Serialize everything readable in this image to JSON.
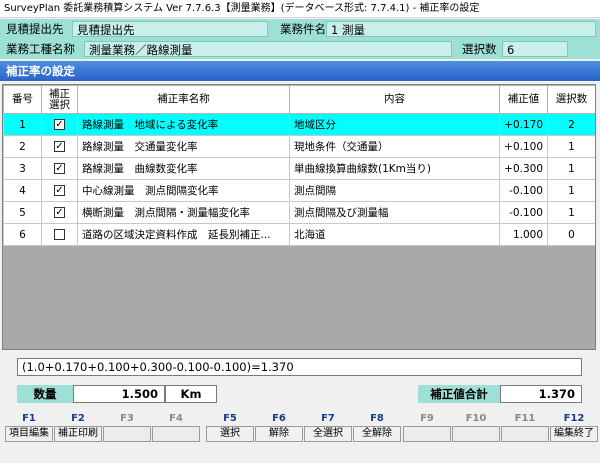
{
  "window": {
    "title": "SurveyPlan 委託業務積算システム Ver 7.7.6.3【測量業務】(データベース形式: 7.7.4.1) - 補正率の設定"
  },
  "info": {
    "submit_label": "見積提出先",
    "submit_value": "見積提出先",
    "project_label": "業務件名",
    "project_value": "1 測量",
    "category_label": "業務工種名称",
    "category_value": "測量業務／路線測量",
    "selected_label": "選択数",
    "selected_value": "6"
  },
  "section": {
    "title": "補正率の設定"
  },
  "table": {
    "headers": {
      "num": "番号",
      "select": "補正\n選択",
      "name": "補正率名称",
      "content": "内容",
      "value": "補正値",
      "count": "選択数"
    },
    "rows": [
      {
        "num": "1",
        "checked": true,
        "name": "路線測量　地域による変化率",
        "content": "地域区分",
        "value": "+0.170",
        "count": "2",
        "selected": true
      },
      {
        "num": "2",
        "checked": true,
        "name": "路線測量　交通量変化率",
        "content": "現地条件（交通量）",
        "value": "+0.100",
        "count": "1",
        "selected": false
      },
      {
        "num": "3",
        "checked": true,
        "name": "路線測量　曲線数変化率",
        "content": "単曲線換算曲線数(1Km当り)",
        "value": "+0.300",
        "count": "1",
        "selected": false
      },
      {
        "num": "4",
        "checked": true,
        "name": "中心線測量　測点間隔変化率",
        "content": "測点間隔",
        "value": "-0.100",
        "count": "1",
        "selected": false
      },
      {
        "num": "5",
        "checked": true,
        "name": "横断測量　測点間隔・測量幅変化率",
        "content": "測点間隔及び測量幅",
        "value": "-0.100",
        "count": "1",
        "selected": false
      },
      {
        "num": "6",
        "checked": false,
        "name": "道路の区域決定資料作成　延長別補正...",
        "content": "北海道",
        "value": "1.000",
        "count": "0",
        "selected": false
      }
    ]
  },
  "formula": "(1.0+0.170+0.100+0.300-0.100-0.100)=1.370",
  "summary": {
    "qty_label": "数量",
    "qty_value": "1.500",
    "unit": "Km",
    "total_label": "補正値合計",
    "total_value": "1.370"
  },
  "fkeys": [
    {
      "key": "F1",
      "label": "項目編集",
      "enabled": true
    },
    {
      "key": "F2",
      "label": "補正印刷",
      "enabled": true
    },
    {
      "key": "F3",
      "label": "",
      "enabled": false
    },
    {
      "key": "F4",
      "label": "",
      "enabled": false
    },
    {
      "key": "F5",
      "label": "選択",
      "enabled": true
    },
    {
      "key": "F6",
      "label": "解除",
      "enabled": true
    },
    {
      "key": "F7",
      "label": "全選択",
      "enabled": true
    },
    {
      "key": "F8",
      "label": "全解除",
      "enabled": true
    },
    {
      "key": "F9",
      "label": "",
      "enabled": false
    },
    {
      "key": "F10",
      "label": "",
      "enabled": false
    },
    {
      "key": "F11",
      "label": "",
      "enabled": false
    },
    {
      "key": "F12",
      "label": "編集終了",
      "enabled": true
    }
  ]
}
